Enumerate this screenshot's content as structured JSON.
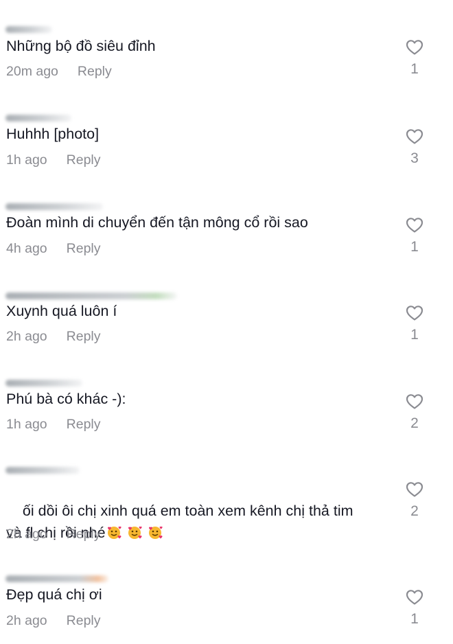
{
  "comments": [
    {
      "text": "Những bộ đồ siêu đỉnh",
      "time": "20m ago",
      "reply": "Reply",
      "likes": "1"
    },
    {
      "text": "Huhhh [photo]",
      "time": "1h ago",
      "reply": "Reply",
      "likes": "3"
    },
    {
      "text": "Đoàn mình di chuyển đến tận mông cổ rồi sao",
      "time": "4h ago",
      "reply": "Reply",
      "likes": "1"
    },
    {
      "text": "Xuynh quá luôn í",
      "time": "2h ago",
      "reply": "Reply",
      "likes": "1"
    },
    {
      "text": "Phú bà có khác -):",
      "time": "1h ago",
      "reply": "Reply",
      "likes": "2"
    },
    {
      "text": "ối dồi ôi chị xinh quá em toàn xem kênh chị thả tim\nvà fl chị rồi nhé",
      "time": "2h ago",
      "reply": "Reply",
      "likes": "2",
      "emoji_icons": [
        "smiling-face-with-hearts-emoji",
        "smiling-face-with-hearts-emoji",
        "smiling-face-with-hearts-emoji"
      ]
    },
    {
      "text": "Đẹp quá chị ơi",
      "time": "2h ago",
      "reply": "Reply",
      "likes": "1"
    }
  ],
  "icons": {
    "like": "heart-outline-icon"
  },
  "colors": {
    "text": "#161823",
    "secondary": "#8a8b91",
    "background": "#ffffff"
  }
}
